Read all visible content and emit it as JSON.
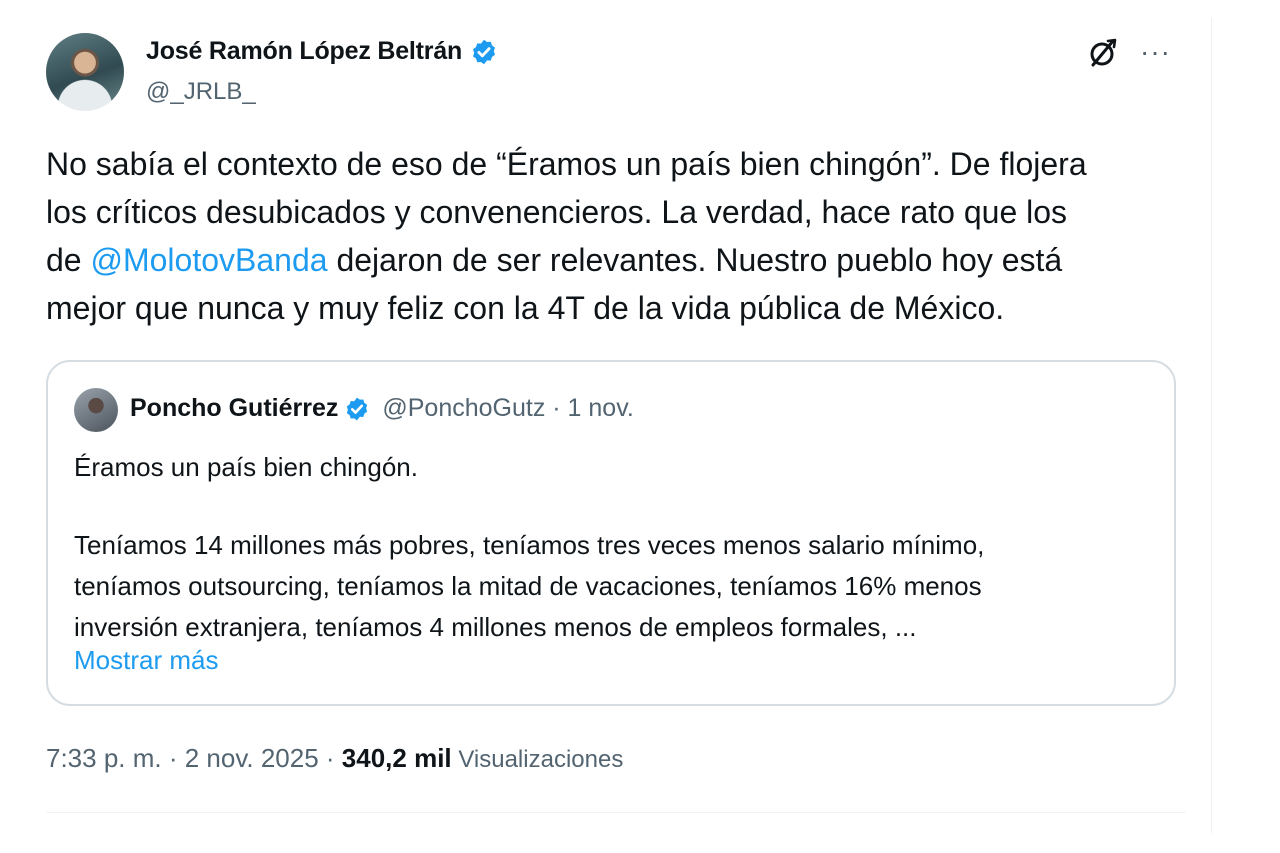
{
  "tweet": {
    "author": {
      "name": "José Ramón López Beltrán",
      "handle": "@_JRLB_",
      "verified": true
    },
    "text_parts": {
      "line1": "No sabía el contexto de eso de “Éramos un país bien chingón”. De flojera",
      "line2": "los críticos desubicados y convenencieros. La verdad, hace rato que los",
      "line3_prefix": "de ",
      "mention": "@MolotovBanda",
      "line3_suffix": " dejaron de ser relevantes. Nuestro pueblo hoy está",
      "line4": "mejor que nunca y muy feliz con la 4T de la vida pública de México."
    },
    "timestamp": "7:33 p. m. · 2 nov. 2025 · ",
    "views_count": "340,2 mil",
    "views_label": " Visualizaciones"
  },
  "quote": {
    "author": {
      "name": "Poncho Gutiérrez",
      "handle_date": "@PonchoGutz · 1 nov.",
      "verified": true
    },
    "first_line": "Éramos un país bien chingón.",
    "body_lines": [
      "Teníamos 14 millones más pobres, teníamos tres veces menos salario mínimo,",
      "teníamos outsourcing, teníamos la mitad de vacaciones, teníamos 16% menos",
      "inversión extranjera, teníamos 4 millones menos de empleos formales, ..."
    ],
    "show_more": "Mostrar más"
  },
  "icons": {
    "verified": "verified-badge-icon",
    "grok": "grok-icon",
    "more": "more-options-icon"
  },
  "colors": {
    "accent": "#1d9bf0",
    "text": "#0f1419",
    "muted": "#536471",
    "border": "#d6dde2"
  }
}
